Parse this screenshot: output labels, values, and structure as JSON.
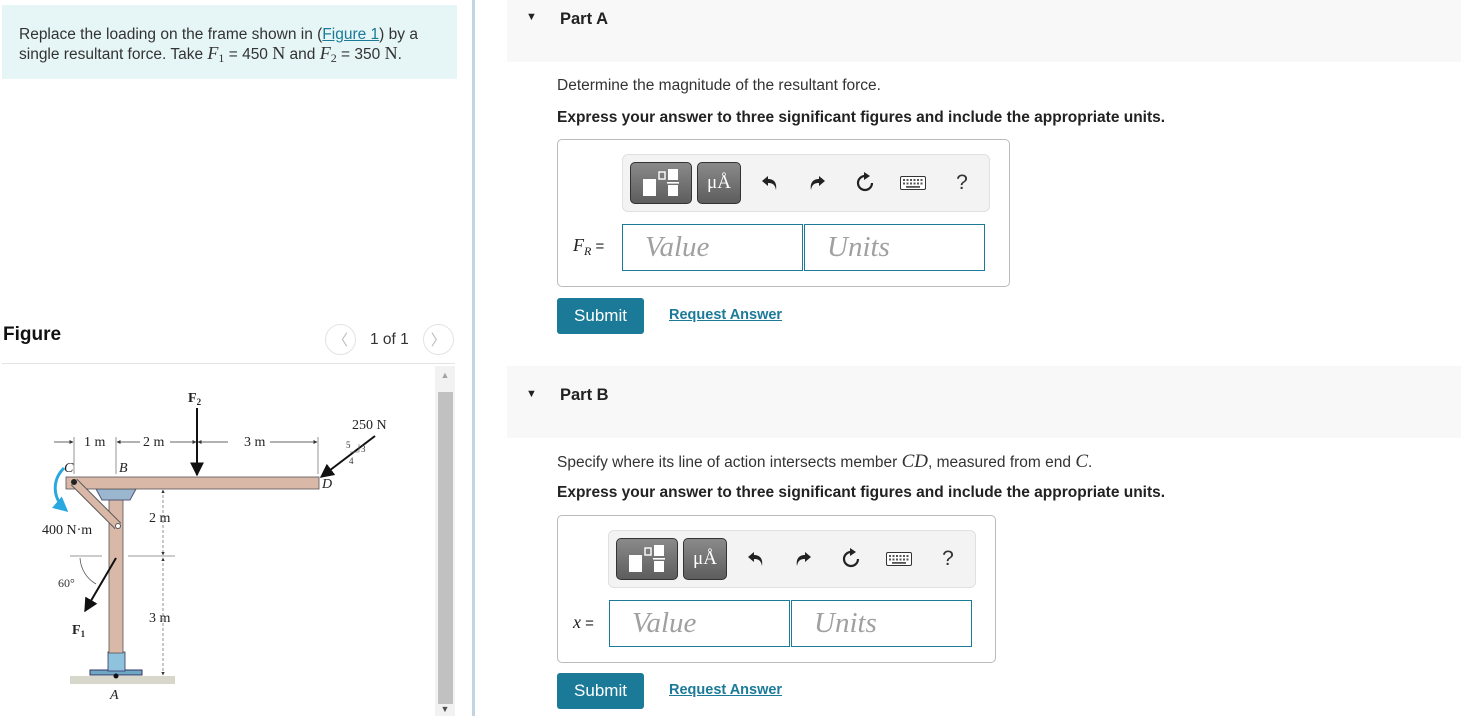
{
  "problem": {
    "text_before": "Replace the loading on the frame shown in (",
    "figure_link": "Figure 1",
    "text_mid": ") by a single resultant force. Take ",
    "f1_symbol": "F",
    "f1_sub": "1",
    "f1_value": " = 450 ",
    "f1_unit": "N",
    "and": " and ",
    "f2_symbol": "F",
    "f2_sub": "2",
    "f2_value": " = 350 ",
    "f2_unit": "N",
    "end": "."
  },
  "figure_panel": {
    "title": "Figure",
    "pager_text": "1 of 1",
    "prev_icon": "chevron-left-icon",
    "next_icon": "chevron-right-icon"
  },
  "diagram": {
    "labels": {
      "F2": "F",
      "F2_sub": "2",
      "F1": "F",
      "F1_sub": "1",
      "load_250": "250 N",
      "slope_5": "5",
      "slope_3": "3",
      "slope_4": "4",
      "dim_1m": "1 m",
      "dim_2m_top": "2 m",
      "dim_3m_top": "3 m",
      "dim_2m_side": "2 m",
      "dim_3m_side": "3 m",
      "moment": "400 N·m",
      "angle": "60°",
      "point_C": "C",
      "point_B": "B",
      "point_D": "D",
      "point_A": "A"
    },
    "colors": {
      "wood": "#d9b8a8",
      "moment_arrow": "#29a8e0",
      "base": "#8fc3dd"
    }
  },
  "parts": [
    {
      "title": "Part A",
      "question": "Determine the magnitude of the resultant force.",
      "instruction": "Express your answer to three significant figures and include the appropriate units.",
      "var_symbol": "F",
      "var_sub": "R",
      "equals": " =",
      "value_placeholder": "Value",
      "units_placeholder": "Units",
      "submit_label": "Submit",
      "request_label": "Request Answer"
    },
    {
      "title": "Part B",
      "question_before": "Specify where its line of action intersects member ",
      "question_math1": "CD",
      "question_mid": ", measured from end ",
      "question_math2": "C",
      "question_end": ".",
      "instruction": "Express your answer to three significant figures and include the appropriate units.",
      "var_symbol": "x",
      "equals": " =",
      "value_placeholder": "Value",
      "units_placeholder": "Units",
      "submit_label": "Submit",
      "request_label": "Request Answer"
    }
  ],
  "toolbar": {
    "templates_icon": "fraction-template-icon",
    "symbols_label": "μÅ",
    "undo_icon": "undo-icon",
    "redo_icon": "redo-icon",
    "reset_icon": "reset-icon",
    "keyboard_icon": "keyboard-icon",
    "help_label": "?"
  },
  "toggle_glyph": "▼",
  "colors": {
    "accent": "#1a7a98",
    "problem_bg": "#e6f5f6",
    "part_header_bg": "#f8f8f8"
  }
}
